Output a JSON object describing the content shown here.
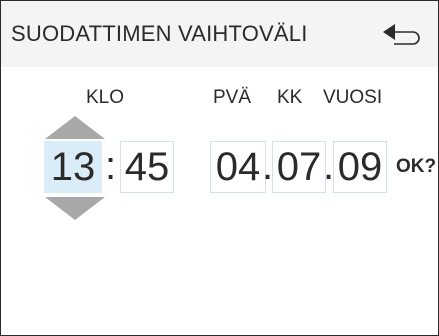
{
  "header": {
    "title": "SUODATTIMEN VAIHTOVÄLI",
    "back_icon": "return-arrow-icon"
  },
  "labels": {
    "time": "KLO",
    "day": "PVÄ",
    "month": "KK",
    "year": "VUOSI"
  },
  "time": {
    "hours": "13",
    "separator": ":",
    "minutes": "45"
  },
  "date": {
    "day": "04",
    "month": "07",
    "year": "09",
    "separator": "."
  },
  "confirm": "OK?",
  "colors": {
    "active_field": "#d9ecf7",
    "field_border": "#cfe3f0",
    "arrow": "#a8a8a8",
    "header_bg": "#f4f4f4"
  }
}
